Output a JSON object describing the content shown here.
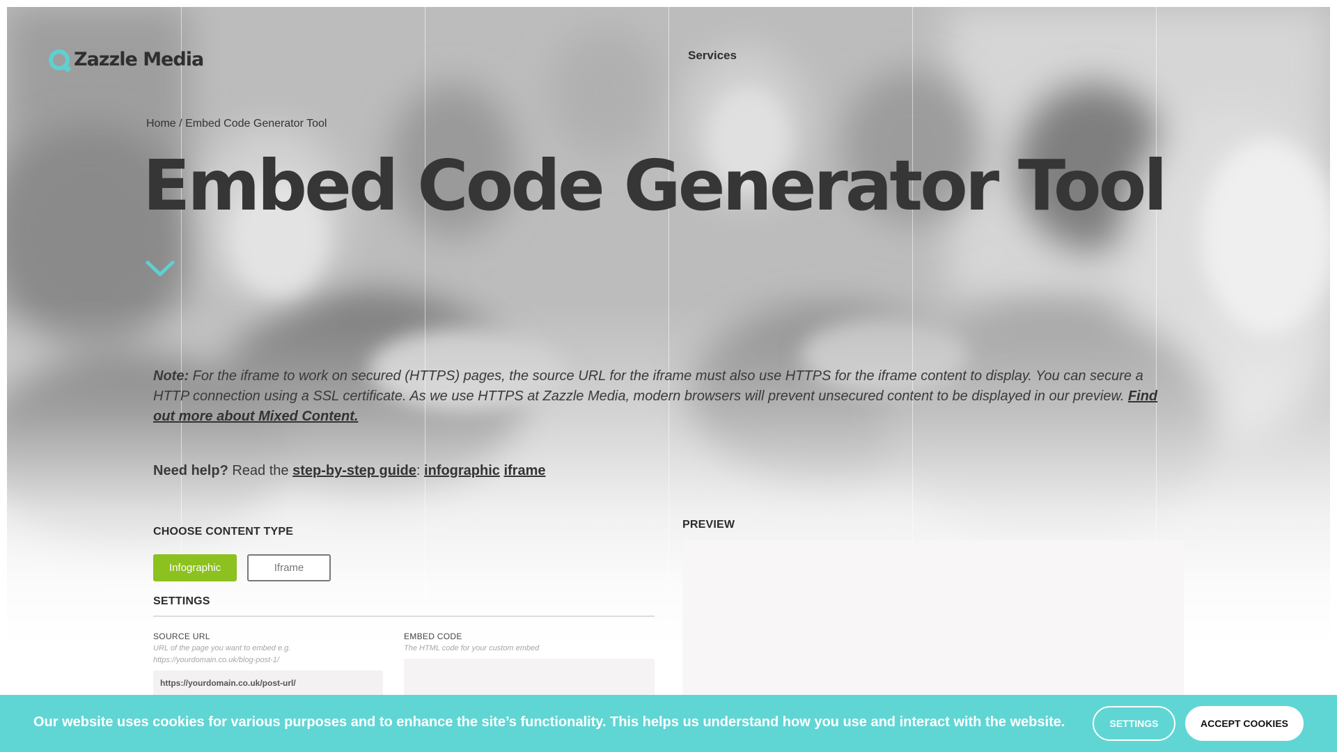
{
  "brand": {
    "logo_text": "Zazzle Media",
    "accent_color": "#5fd0d0"
  },
  "nav": {
    "services_label": "Services"
  },
  "breadcrumb": {
    "home": "Home",
    "separator": " / ",
    "current": "Embed Code Generator Tool"
  },
  "page_title": "Embed Code Generator Tool",
  "note": {
    "label": "Note:",
    "text": " For the iframe to work on secured (HTTPS) pages, the source URL for the iframe must also use HTTPS for the iframe content to display. You can secure a HTTP connection using a SSL certificate. As we use HTTPS at Zazzle Media, modern browsers will prevent unsecured content to be displayed in our preview. ",
    "link": "Find out more about Mixed Content."
  },
  "help": {
    "label": "Need help?",
    "text": " Read the ",
    "guide_link": "step-by-step guide",
    "colon": ": ",
    "infographic_link": "infographic",
    "space": " ",
    "iframe_link": "iframe"
  },
  "content_type": {
    "heading": "CHOOSE CONTENT TYPE",
    "options": [
      "Infographic",
      "Iframe"
    ],
    "selected": "Infographic",
    "selected_color": "#8cc11f"
  },
  "settings": {
    "heading": "SETTINGS",
    "source_url": {
      "label": "SOURCE URL",
      "hint": "URL of the page you want to embed e.g. https://yourdomain.co.uk/blog-post-1/",
      "value": "https://yourdomain.co.uk/post-url/"
    },
    "embed_code": {
      "label": "EMBED CODE",
      "hint": "The HTML code for your custom embed",
      "value": ""
    }
  },
  "preview": {
    "heading": "PREVIEW"
  },
  "cookie_banner": {
    "text": "Our website uses cookies for various purposes and to enhance the site’s functionality. This helps us understand how you use and interact with the website.",
    "settings_label": "SETTINGS",
    "accept_label": "ACCEPT COOKIES",
    "background_color": "#5fd6d4"
  }
}
